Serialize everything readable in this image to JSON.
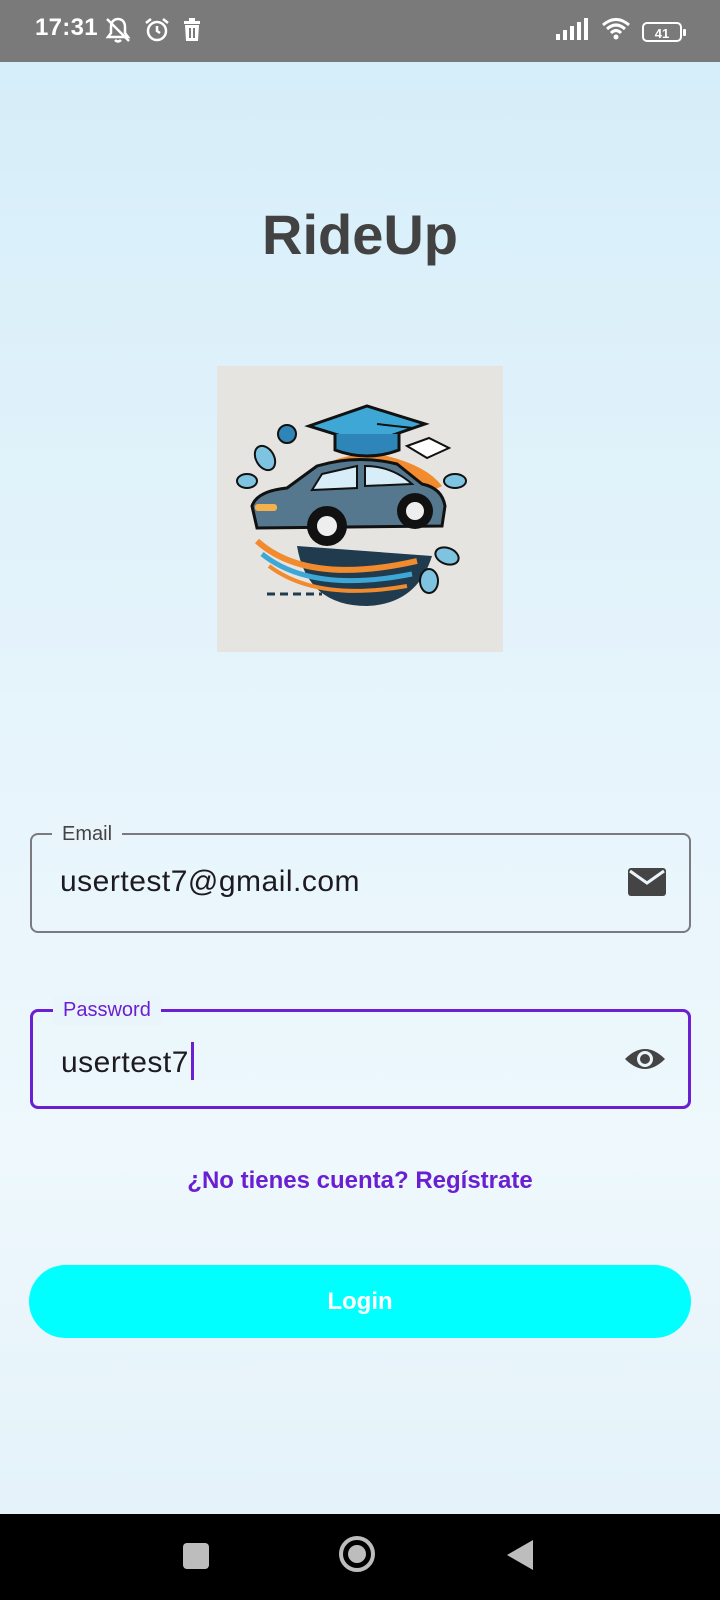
{
  "status_bar": {
    "time": "17:31",
    "battery": "41",
    "left_icons": [
      "mute-notifications-icon",
      "alarm-icon",
      "trash-icon"
    ],
    "right_icons": [
      "signal-icon",
      "wifi-icon",
      "battery-icon"
    ]
  },
  "app": {
    "title": "RideUp"
  },
  "form": {
    "email": {
      "label": "Email",
      "value": "usertest7@gmail.com",
      "icon": "mail-icon"
    },
    "password": {
      "label": "Password",
      "value": "usertest7",
      "icon": "eye-icon"
    },
    "register_link": "¿No tienes cuenta? Regístrate",
    "login_label": "Login"
  },
  "colors": {
    "accent": "#6a1fd2",
    "button": "#00ffff",
    "title": "#424242"
  },
  "nav_bar": {
    "buttons": [
      "recents-button",
      "home-button",
      "back-button"
    ]
  }
}
